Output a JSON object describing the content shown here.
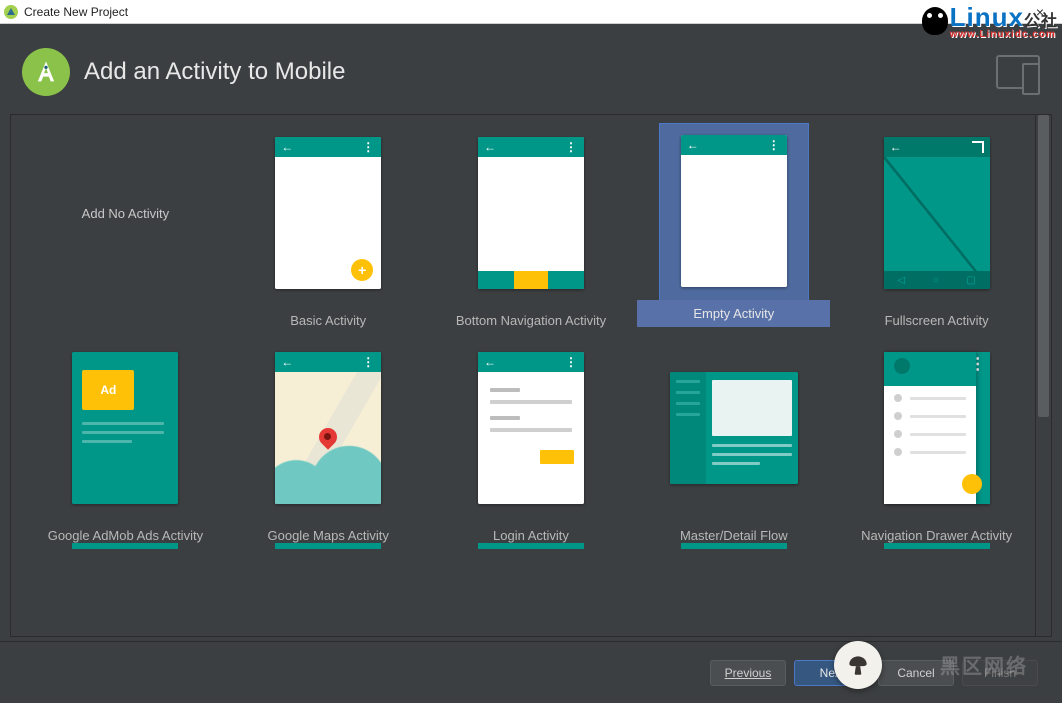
{
  "titlebar": {
    "title": "Create New Project",
    "close_icon": "×"
  },
  "header": {
    "title": "Add an Activity to Mobile"
  },
  "activities": [
    {
      "id": "add-no-activity",
      "label": "Add No Activity",
      "kind": "none",
      "selected": false
    },
    {
      "id": "basic-activity",
      "label": "Basic Activity",
      "kind": "basic",
      "selected": false
    },
    {
      "id": "bottom-navigation-activity",
      "label": "Bottom Navigation Activity",
      "kind": "bottomnav",
      "selected": false
    },
    {
      "id": "empty-activity",
      "label": "Empty Activity",
      "kind": "empty",
      "selected": true
    },
    {
      "id": "fullscreen-activity",
      "label": "Fullscreen Activity",
      "kind": "fullscreen",
      "selected": false
    },
    {
      "id": "google-admob-ads-activity",
      "label": "Google AdMob Ads Activity",
      "kind": "admob",
      "selected": false
    },
    {
      "id": "google-maps-activity",
      "label": "Google Maps Activity",
      "kind": "maps",
      "selected": false
    },
    {
      "id": "login-activity",
      "label": "Login Activity",
      "kind": "login",
      "selected": false
    },
    {
      "id": "master-detail-flow",
      "label": "Master/Detail Flow",
      "kind": "masterdetail",
      "selected": false
    },
    {
      "id": "navigation-drawer-activity",
      "label": "Navigation Drawer Activity",
      "kind": "navdrawer",
      "selected": false
    }
  ],
  "footer": {
    "previous": "Previous",
    "next": "Next",
    "cancel": "Cancel",
    "finish": "Finish"
  },
  "icons": {
    "back_arrow": "←",
    "menu_dots": "⋮",
    "fab_plus": "+",
    "ad_label": "Ad"
  },
  "watermark": {
    "linux_text": "Linux",
    "linux_sub": "www.Linuxidc.com",
    "bottom_text": "黑区网络"
  },
  "colors": {
    "accent_teal": "#009688",
    "accent_teal_dark": "#00796b",
    "selection": "#4a78c7",
    "amber": "#ffc107",
    "window_bg": "#3c3f41"
  }
}
